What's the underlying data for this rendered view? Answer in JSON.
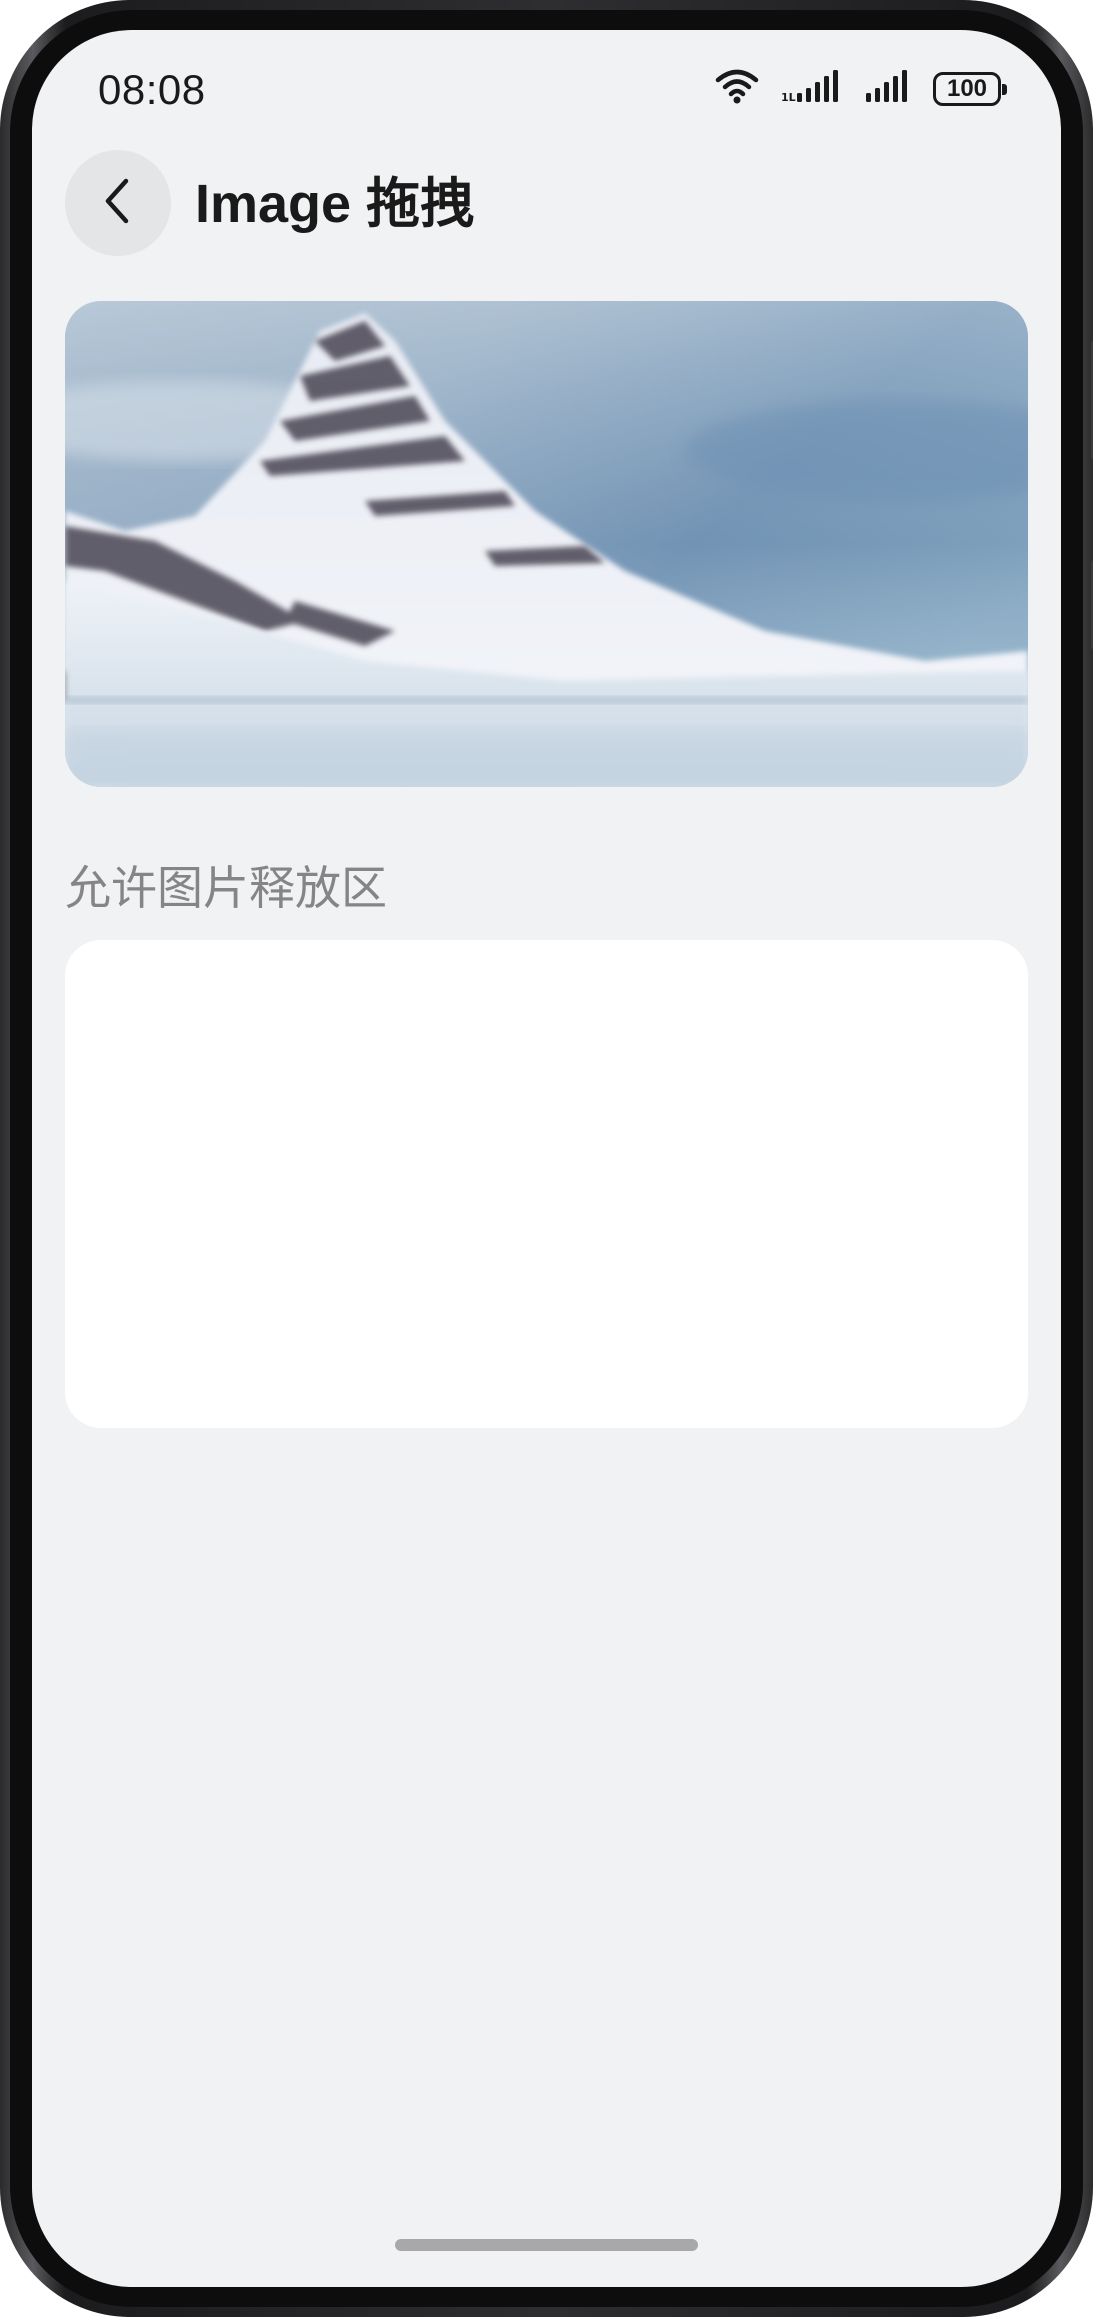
{
  "status_bar": {
    "time": "08:08",
    "battery": "100",
    "icons": [
      "wifi-icon",
      "signal-icon",
      "signal-icon",
      "battery-icon"
    ]
  },
  "header": {
    "back_icon": "chevron-left-icon",
    "title": "Image 拖拽"
  },
  "image_card": {
    "image": "snowy-mountain-photo"
  },
  "drop_section": {
    "label": "允许图片释放区"
  },
  "colors": {
    "background": "#f1f2f4",
    "card": "#ffffff",
    "title_text": "#1a1a1a",
    "label_text": "#858585"
  }
}
